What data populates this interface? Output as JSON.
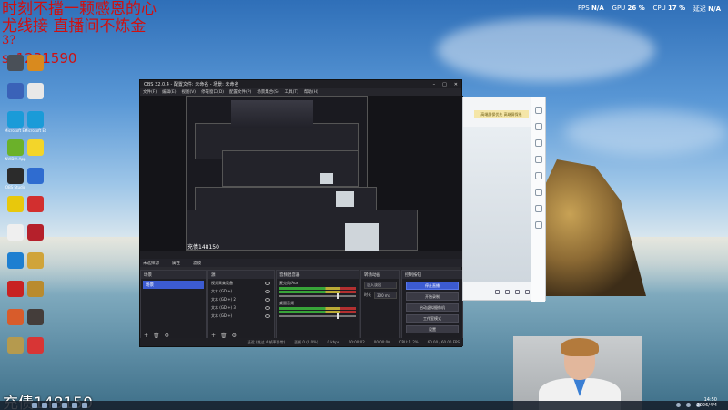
{
  "overlay": {
    "line1": "时刻不擋一颗感恩的心",
    "line2": "尤线接  直播间不炼金",
    "line3": "3?",
    "line4": "ss1231590",
    "bottom": "充债148150"
  },
  "system_stats": {
    "fps_label": "FPS",
    "fps_value": "N/A",
    "gpu_label": "GPU",
    "gpu_value": "26 %",
    "cpu_label": "CPU",
    "cpu_value": "17 %",
    "latency_label": "延迟",
    "latency_value": "N/A"
  },
  "desktop_icons": [
    {
      "label": "",
      "color": "#4a5058"
    },
    {
      "label": "",
      "color": "#d98a1e"
    },
    {
      "label": "",
      "color": "#3a62b8"
    },
    {
      "label": "",
      "color": "#e8e8e8"
    },
    {
      "label": "Microsoft Edge",
      "color": "#1a9bd8"
    },
    {
      "label": "Microsoft Edge",
      "color": "#1a9bd8"
    },
    {
      "label": "NVIDIA App",
      "color": "#6bb12a"
    },
    {
      "label": "",
      "color": "#f3d52a"
    },
    {
      "label": "OBS Studio",
      "color": "#2b2b2b"
    },
    {
      "label": "",
      "color": "#2f6cd0"
    },
    {
      "label": "",
      "color": "#e8c80c"
    },
    {
      "label": "",
      "color": "#d22f2f"
    },
    {
      "label": "",
      "color": "#efefef"
    },
    {
      "label": "",
      "color": "#b5202b"
    },
    {
      "label": "",
      "color": "#1d7fd1"
    },
    {
      "label": "",
      "color": "#d0a43a"
    },
    {
      "label": "",
      "color": "#c82222"
    },
    {
      "label": "",
      "color": "#b98b2e"
    },
    {
      "label": "",
      "color": "#d85c2b"
    },
    {
      "label": "",
      "color": "#443d3a"
    },
    {
      "label": "",
      "color": "#b59a4e"
    },
    {
      "label": "",
      "color": "#d83535"
    }
  ],
  "obs": {
    "title": "OBS 32.0.4 - 配置文件: 未命名 - 场景: 未命名",
    "menu": [
      "文件(F)",
      "编辑(E)",
      "视图(V)",
      "停靠窗口(D)",
      "配置文件(P)",
      "场景集合(S)",
      "工具(T)",
      "帮助(H)"
    ],
    "preview_text": "充债148150",
    "scene_tabs": [
      "未选择源",
      "属性",
      "滤镜"
    ],
    "docks": {
      "scenes_title": "场景",
      "scene_active": "场景",
      "sources_title": "源",
      "sources": [
        "视频采集设备",
        "文本 (GDI+)",
        "文本 (GDI+) 2",
        "文本 (GDI+) 3",
        "文本 (GDI+)"
      ],
      "mixer_title": "音频混音器",
      "mixer": [
        "麦克风/Aux",
        "桌面音频"
      ],
      "trans_title": "转场动画",
      "trans_type": "淡入淡出",
      "trans_dur_label": "时长",
      "trans_dur_value": "300 ms",
      "controls_title": "控制按钮",
      "controls": [
        "停止直播",
        "开始录制",
        "启动虚拟摄像机",
        "工作室模式",
        "设置"
      ]
    },
    "status": [
      "延迟 (跳过 4 帧率异常)",
      "丢帧 0 (0.0%)",
      "0 kbps",
      "00:00:02",
      "00:00:00",
      "CPU: 1.2%",
      "60.00 / 60.00 FPS"
    ]
  },
  "sideapp": {
    "tag": "高端屏保优先  高端屏保系"
  },
  "clock": {
    "time": "14:50",
    "date": "2026/4/4"
  }
}
